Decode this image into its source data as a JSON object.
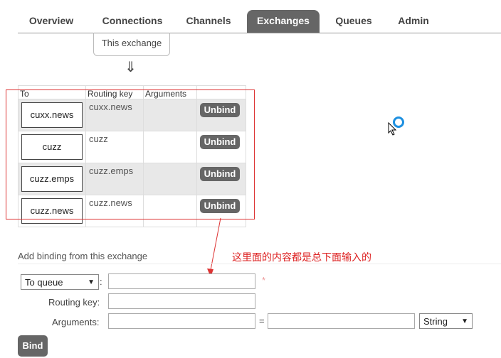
{
  "nav": {
    "tabs": [
      {
        "label": "Overview"
      },
      {
        "label": "Connections"
      },
      {
        "label": "Channels"
      },
      {
        "label": "Exchanges"
      },
      {
        "label": "Queues"
      },
      {
        "label": "Admin"
      }
    ],
    "active": "Exchanges"
  },
  "this_exchange": "This exchange",
  "down_arrow": "⇓",
  "table": {
    "headers": [
      "To",
      "Routing key",
      "Arguments",
      ""
    ],
    "rows": [
      {
        "to": "cuxx.news",
        "routing_key": "cuxx.news",
        "arguments": "",
        "action": "Unbind"
      },
      {
        "to": "cuzz",
        "routing_key": "cuzz",
        "arguments": "",
        "action": "Unbind"
      },
      {
        "to": "cuzz.emps",
        "routing_key": "cuzz.emps",
        "arguments": "",
        "action": "Unbind"
      },
      {
        "to": "cuzz.news",
        "routing_key": "cuzz.news",
        "arguments": "",
        "action": "Unbind"
      }
    ]
  },
  "annotation": "这里面的内容都是总下面输入的",
  "add_binding": {
    "title": "Add binding from this exchange",
    "destination_type": "To queue",
    "colon": ":",
    "required_mark": "*",
    "routing_key_label": "Routing key:",
    "arguments_label": "Arguments:",
    "equals": "=",
    "arg_type": "String",
    "bind_label": "Bind"
  },
  "colors": {
    "tab_active_bg": "#666666",
    "button_bg": "#666666",
    "highlight": "#dd3333",
    "spinner": "#1e90e0"
  }
}
